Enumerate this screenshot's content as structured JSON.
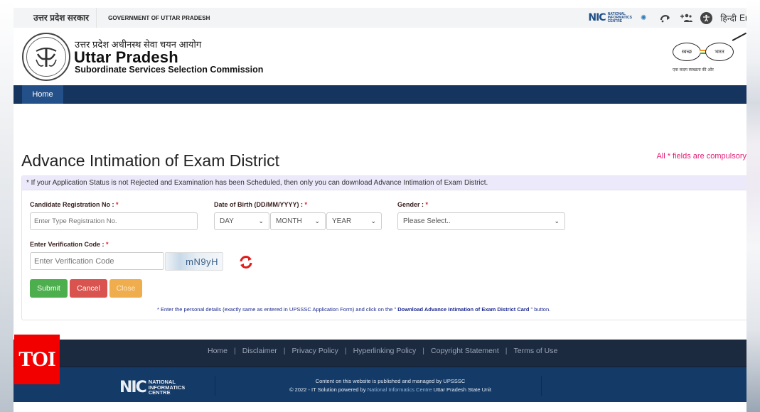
{
  "gov_bar": {
    "hindi_label": "उत्तर प्रदेश सरकार",
    "english_label": "GOVERNMENT OF UTTAR PRADESH",
    "nic_mark": "NIC",
    "nic_words": [
      "NATIONAL",
      "INFORMATICS",
      "CENTRE"
    ],
    "icons": [
      "gear-icon",
      "skip-to-content-icon",
      "add-user-icon",
      "accessibility-icon"
    ],
    "lang_hindi": "हिन्दी",
    "lang_english": "English"
  },
  "header": {
    "hindi_title": "उत्तर प्रदेश अधीनस्थ सेवा चयन आयोग",
    "title": "Uttar Pradesh",
    "subtitle": "Subordinate Services Selection Commission",
    "swachh_left": "स्वच्छ",
    "swachh_right": "भारत",
    "swachh_tagline": "एक कदम स्वच्छता की ओर",
    "swachh_colors": [
      "#f7931e",
      "#ffffff",
      "#3aa935"
    ]
  },
  "nav": {
    "items": [
      {
        "label": "Home",
        "active": true
      }
    ]
  },
  "page": {
    "title": "Advance Intimation of Exam District",
    "compulsory_note": "All * fields are compulsory",
    "info_banner": "* If your Application Status is not Rejected and Examination has been Scheduled, then only you can download Advance Intimation of Exam District."
  },
  "form": {
    "registration": {
      "label": "Candidate Registration No :",
      "required_mark": "*",
      "value": "",
      "placeholder": "Enter Type Registration No."
    },
    "dob": {
      "label": "Date of Birth (DD/MM/YYYY) :",
      "required_mark": "*",
      "day": "DAY",
      "month": "MONTH",
      "year": "YEAR"
    },
    "gender": {
      "label": "Gender :",
      "required_mark": "*",
      "selected": "Please Select.."
    },
    "verification": {
      "label": "Enter Verification Code :",
      "required_mark": "*",
      "value": "",
      "placeholder": "Enter Verification Code"
    },
    "captcha_text": "mN9yH",
    "buttons": {
      "submit": "Submit",
      "cancel": "Cancel",
      "close": "Close"
    },
    "note_prefix": "* Enter the personal details (exactly same as entered in UPSSSC Application Form) and click on the \"",
    "note_bold": " Download Advance Intimation of Exam District Card ",
    "note_suffix": "\" button."
  },
  "footer": {
    "links": [
      "Home",
      "Disclaimer",
      "Privacy Policy",
      "Hyperlinking Policy",
      "Copyright Statement",
      "Terms of Use"
    ],
    "nic_mark": "NIC",
    "nic_words": [
      "NATIONAL",
      "INFORMATICS",
      "CENTRE"
    ],
    "line1": "Content on this website is published and managed by UPSSSC",
    "line2_prefix": "© 2022 - IT Solution powered by ",
    "line2_link": "National Informatics Centre",
    "line2_suffix": " Uttar Pradesh State Unit"
  },
  "watermark": {
    "text": "TOI"
  },
  "colors": {
    "nav_bg": "#15345e",
    "nav_active": "#245089",
    "compulsory": "#e21f77",
    "submit": "#4cae4c",
    "cancel": "#d9534f",
    "close": "#f0ad4e",
    "footer_top": "#1c2a40",
    "footer_bottom": "#143a67",
    "watermark": "#f20000"
  }
}
